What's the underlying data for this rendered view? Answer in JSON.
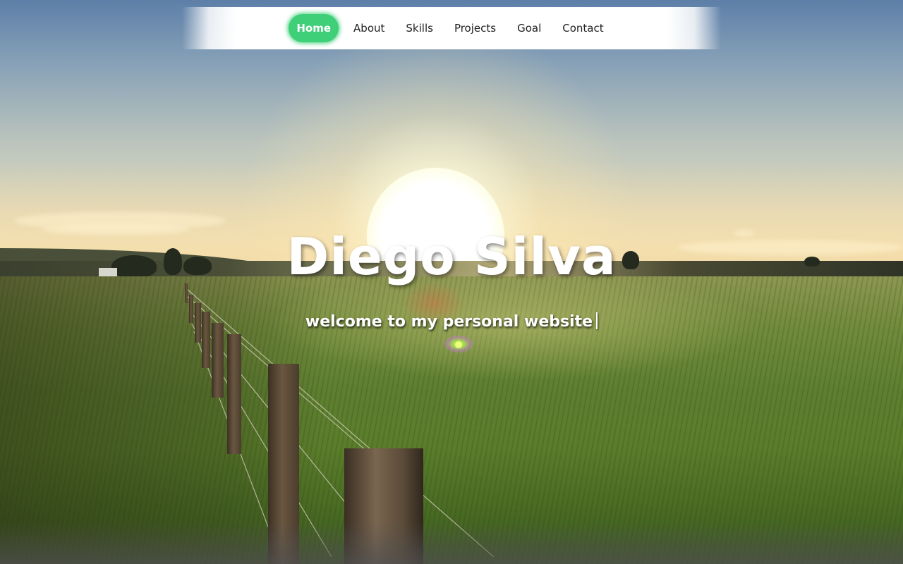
{
  "nav": {
    "items": [
      {
        "label": "Home",
        "active": true
      },
      {
        "label": "About"
      },
      {
        "label": "Skills"
      },
      {
        "label": "Projects"
      },
      {
        "label": "Goal"
      },
      {
        "label": "Contact"
      }
    ]
  },
  "hero": {
    "title": "Diego Silva",
    "subtitle": "welcome to my personal website"
  },
  "colors": {
    "accent": "#3fcf78",
    "nav_background": "#ffffff",
    "text": "#ffffff"
  },
  "background": {
    "description_icon": "sunset-field-photo"
  }
}
